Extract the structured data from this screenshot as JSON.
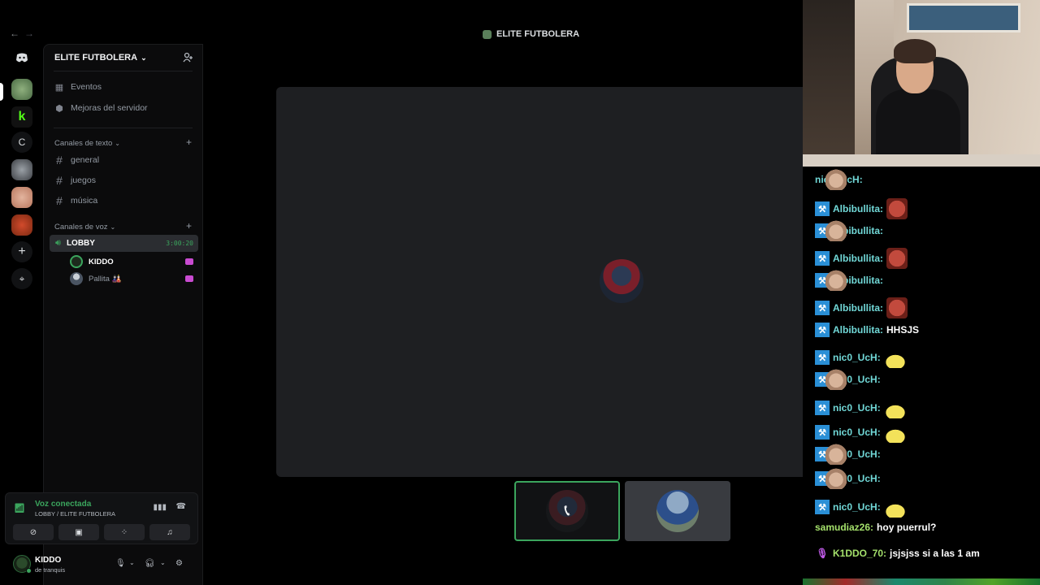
{
  "window": {
    "title": "ELITE FUTBOLERA",
    "back": "←",
    "forward": "→"
  },
  "server": {
    "name": "ELITE FUTBOLERA"
  },
  "rail": [
    {
      "name": "discord-home-icon",
      "glyph": ""
    },
    {
      "name": "server-elite",
      "glyph": ""
    },
    {
      "name": "server-kick",
      "glyph": "k"
    },
    {
      "name": "server-c",
      "glyph": "C"
    },
    {
      "name": "server-3",
      "glyph": ""
    },
    {
      "name": "server-4",
      "glyph": ""
    },
    {
      "name": "server-5",
      "glyph": ""
    },
    {
      "name": "add-server",
      "glyph": "+"
    },
    {
      "name": "explore",
      "glyph": "⌖"
    }
  ],
  "nav": {
    "events": "Eventos",
    "boosts": "Mejoras del servidor"
  },
  "text_category": "Canales de texto",
  "text_channels": [
    "general",
    "juegos",
    "música"
  ],
  "voice_category": "Canales de voz",
  "voice_channel": {
    "name": "LOBBY",
    "timer": "3:00:20"
  },
  "members": [
    {
      "name": "KIDDO"
    },
    {
      "name": "Pallita 🎎"
    }
  ],
  "voice_panel": {
    "title": "Voz conectada",
    "subtitle": "LOBBY / ELITE FUTBOLERA"
  },
  "user": {
    "name": "KIDDO",
    "status": "de tranquis"
  },
  "chat": [
    {
      "user": "nic0_UcH:",
      "badge": "",
      "emotes": [
        "cat",
        "cat",
        "cat",
        "cat",
        "cat"
      ],
      "text": ""
    },
    {
      "user": "Albibullita:",
      "badge": "vip",
      "emotes": [
        "face"
      ],
      "text": ""
    },
    {
      "user": "Albibullita:",
      "badge": "vip",
      "emotes": [
        "cat"
      ],
      "text": ""
    },
    {
      "user": "Albibullita:",
      "badge": "vip",
      "emotes": [
        "face"
      ],
      "text": ""
    },
    {
      "user": "Albibullita:",
      "badge": "vip",
      "emotes": [
        "cat"
      ],
      "text": ""
    },
    {
      "user": "Albibullita:",
      "badge": "vip",
      "emotes": [
        "face"
      ],
      "text": ""
    },
    {
      "user": "Albibullita:",
      "badge": "vip",
      "emotes": [],
      "text": "HHSJS"
    },
    {
      "user": "nic0_UcH:",
      "badge": "vip",
      "emotes": [
        "duck"
      ],
      "text": ""
    },
    {
      "user": "nic0_UcH:",
      "badge": "vip",
      "emotes": [
        "cat"
      ],
      "text": ""
    },
    {
      "user": "nic0_UcH:",
      "badge": "vip",
      "emotes": [
        "duck"
      ],
      "text": ""
    },
    {
      "user": "nic0_UcH:",
      "badge": "vip",
      "emotes": [
        "duck"
      ],
      "text": ""
    },
    {
      "user": "nic0_UcH:",
      "badge": "vip",
      "emotes": [
        "cat"
      ],
      "text": ""
    },
    {
      "user": "nic0_UcH:",
      "badge": "vip",
      "emotes": [
        "cat"
      ],
      "text": ""
    },
    {
      "user": "nic0_UcH:",
      "badge": "vip",
      "emotes": [
        "duck"
      ],
      "text": ""
    },
    {
      "user": "samudiaz26:",
      "badge": "",
      "emotes": [],
      "text": "hoy puerrul?",
      "color": "green"
    },
    {
      "user": "K1DDO_70:",
      "badge": "sub",
      "emotes": [],
      "text": "jsjsjss si a las 1 am",
      "color": "green"
    }
  ]
}
